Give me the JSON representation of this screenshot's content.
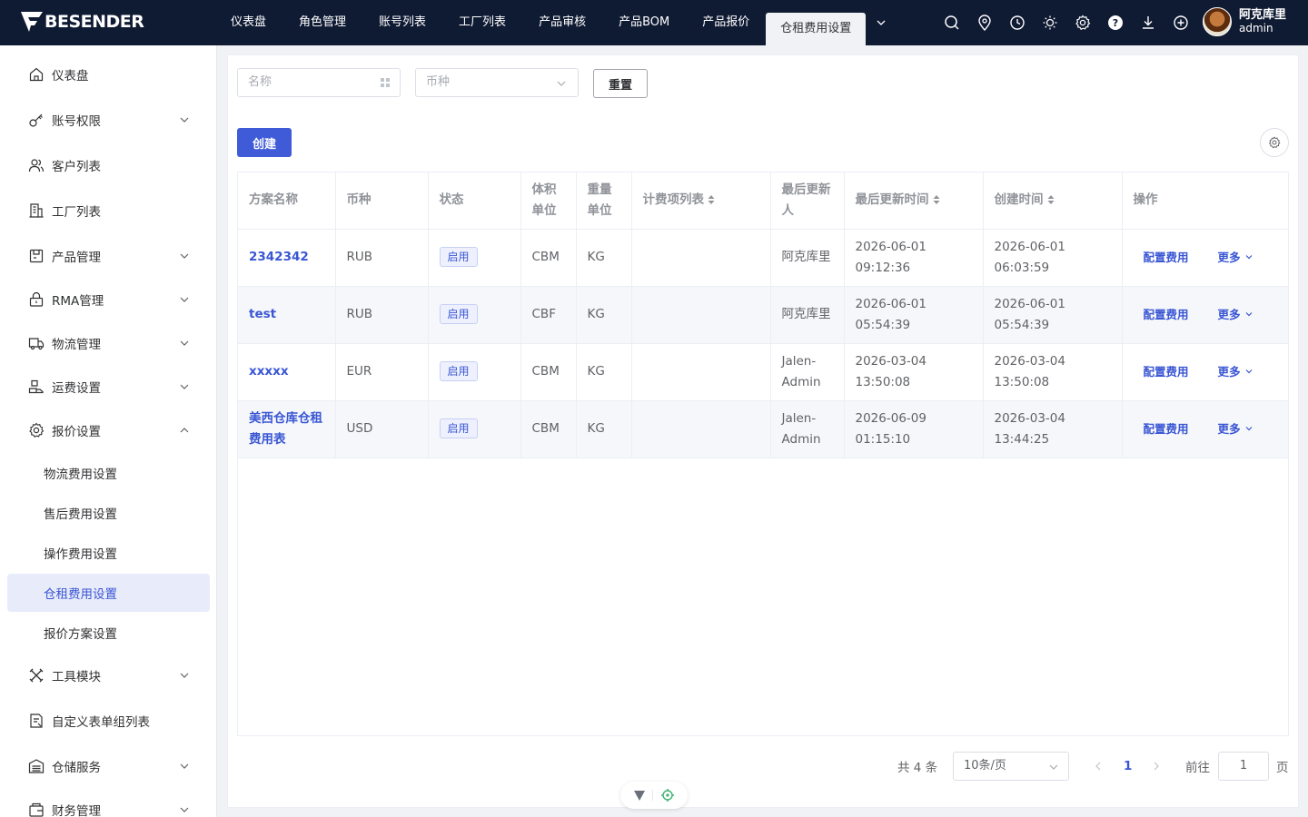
{
  "brand": {
    "name": "BESENDER"
  },
  "nav": {
    "items": [
      "仪表盘",
      "角色管理",
      "账号列表",
      "工厂列表",
      "产品审核",
      "产品BOM",
      "产品报价"
    ],
    "active": "仓租费用设置"
  },
  "user": {
    "name": "阿克库里",
    "role": "admin"
  },
  "sidebar": {
    "items": [
      {
        "label": "仪表盘",
        "icon": "home-icon"
      },
      {
        "label": "账号权限",
        "icon": "key-icon"
      },
      {
        "label": "客户列表",
        "icon": "users-icon"
      },
      {
        "label": "工厂列表",
        "icon": "building-icon"
      },
      {
        "label": "产品管理",
        "icon": "box-icon"
      },
      {
        "label": "RMA管理",
        "icon": "lock-icon"
      },
      {
        "label": "物流管理",
        "icon": "truck-icon"
      },
      {
        "label": "运费设置",
        "icon": "freight-icon"
      },
      {
        "label": "报价设置",
        "icon": "gear-icon"
      },
      {
        "label": "工具模块",
        "icon": "tools-icon"
      },
      {
        "label": "自定义表单组列表",
        "icon": "form-icon"
      },
      {
        "label": "仓储服务",
        "icon": "warehouse-icon"
      },
      {
        "label": "财务管理",
        "icon": "finance-icon"
      }
    ],
    "sub_items": [
      "物流费用设置",
      "售后费用设置",
      "操作费用设置",
      "仓租费用设置",
      "报价方案设置"
    ]
  },
  "filters": {
    "name_placeholder": "名称",
    "currency_placeholder": "币种",
    "reset_label": "重置"
  },
  "toolbar": {
    "create_label": "创建"
  },
  "table": {
    "headers": [
      "方案名称",
      "币种",
      "状态",
      "体积单位",
      "重量单位",
      "计费项列表",
      "最后更新人",
      "最后更新时间",
      "创建时间",
      "操作"
    ],
    "rows": [
      {
        "name": "2342342",
        "currency": "RUB",
        "status": "启用",
        "volume": "CBM",
        "weight": "KG",
        "items": "",
        "updater": "阿克库里",
        "updated": "2026-06-01 09:12:36",
        "created": "2026-06-01 06:03:59"
      },
      {
        "name": "test",
        "currency": "RUB",
        "status": "启用",
        "volume": "CBF",
        "weight": "KG",
        "items": "",
        "updater": "阿克库里",
        "updated": "2026-06-01 05:54:39",
        "created": "2026-06-01 05:54:39"
      },
      {
        "name": "xxxxx",
        "currency": "EUR",
        "status": "启用",
        "volume": "CBM",
        "weight": "KG",
        "items": "",
        "updater": "Jalen-Admin",
        "updated": "2026-03-04 13:50:08",
        "created": "2026-03-04 13:50:08"
      },
      {
        "name": "美西仓库仓租费用表",
        "currency": "USD",
        "status": "启用",
        "volume": "CBM",
        "weight": "KG",
        "items": "",
        "updater": "Jalen-Admin",
        "updated": "2026-06-09 01:15:10",
        "created": "2026-03-04 13:44:25"
      }
    ],
    "op_config": "配置费用",
    "op_more": "更多"
  },
  "pagination": {
    "total_text": "共 4 条",
    "page_size": "10条/页",
    "current_page": "1",
    "goto_label": "前往",
    "goto_value": "1",
    "page_suffix": "页"
  },
  "colors": {
    "topbar": "#0f1a33",
    "accent": "#3f5bd8",
    "active_bg": "#e8ebfa"
  }
}
